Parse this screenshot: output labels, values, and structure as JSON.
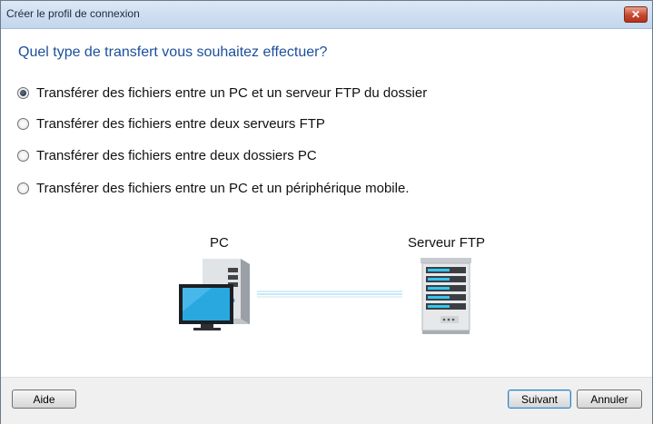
{
  "window": {
    "title": "Créer le profil de connexion",
    "close_glyph": "✕"
  },
  "question": "Quel type de transfert vous souhaitez effectuer?",
  "options": [
    {
      "label": "Transférer des fichiers entre un PC et un serveur FTP du dossier",
      "selected": true
    },
    {
      "label": "Transférer des fichiers entre deux serveurs FTP",
      "selected": false
    },
    {
      "label": "Transférer des fichiers entre deux dossiers PC",
      "selected": false
    },
    {
      "label": "Transférer des fichiers entre un PC et un périphérique mobile.",
      "selected": false
    }
  ],
  "diagram": {
    "pc_label": "PC",
    "server_label": "Serveur FTP",
    "pc_icon": "desktop-computer-icon",
    "server_icon": "server-rack-icon"
  },
  "buttons": {
    "help": "Aide",
    "next": "Suivant",
    "cancel": "Annuler"
  },
  "colors": {
    "question_text": "#1c4f9c",
    "monitor_screen": "#29a8e0",
    "server_lights": "#33c6ef"
  }
}
